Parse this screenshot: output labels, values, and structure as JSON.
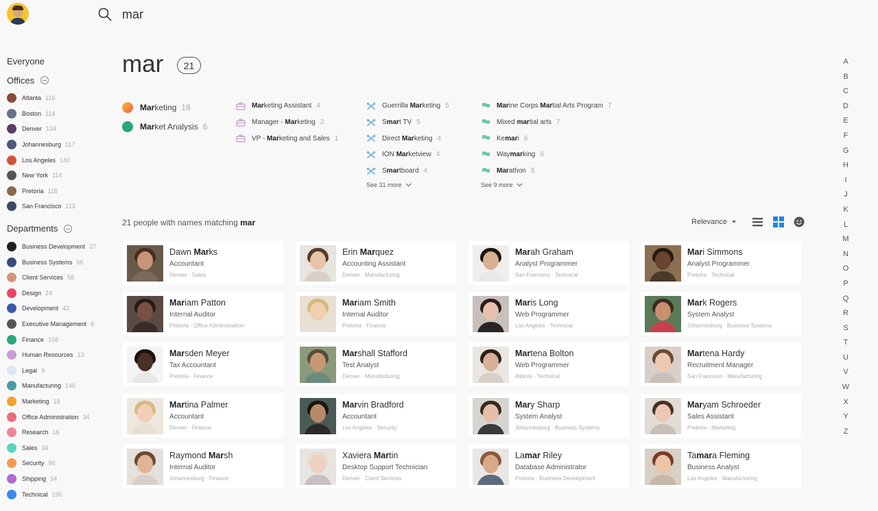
{
  "search": {
    "value": "mar",
    "placeholder": ""
  },
  "sidebar": {
    "everyone": "Everyone",
    "offices_label": "Offices",
    "offices": [
      {
        "label": "Atlanta",
        "count": "116",
        "color": "#8a4a3a"
      },
      {
        "label": "Boston",
        "count": "114",
        "color": "#6a7088"
      },
      {
        "label": "Denver",
        "count": "134",
        "color": "#5a3a6a"
      },
      {
        "label": "Johannesburg",
        "count": "117",
        "color": "#4a5a7a"
      },
      {
        "label": "Los Angeles",
        "count": "140",
        "color": "#d2553a"
      },
      {
        "label": "New York",
        "count": "114",
        "color": "#555555"
      },
      {
        "label": "Pretoria",
        "count": "118",
        "color": "#8a6a4a"
      },
      {
        "label": "San Francisco",
        "count": "113",
        "color": "#3a4a6a"
      }
    ],
    "departments_label": "Departments",
    "departments": [
      {
        "label": "Business Development",
        "count": "27",
        "color": "#222222"
      },
      {
        "label": "Business Systems",
        "count": "66",
        "color": "#3a4a7a"
      },
      {
        "label": "Client Services",
        "count": "58",
        "color": "#d4967a"
      },
      {
        "label": "Design",
        "count": "24",
        "color": "#ee4466"
      },
      {
        "label": "Development",
        "count": "42",
        "color": "#3a5aa8"
      },
      {
        "label": "Executive Management",
        "count": "8",
        "color": "#555555"
      },
      {
        "label": "Finance",
        "count": "158",
        "color": "#2aa878"
      },
      {
        "label": "Human Resources",
        "count": "13",
        "color": "#c89ad8"
      },
      {
        "label": "Legal",
        "count": "9",
        "color": "#dde4f4"
      },
      {
        "label": "Manufacturing",
        "count": "146",
        "color": "#4a9aa8"
      },
      {
        "label": "Marketing",
        "count": "18",
        "color": "#f6a030"
      },
      {
        "label": "Office Administration",
        "count": "34",
        "color": "#ee6a7a"
      },
      {
        "label": "Research",
        "count": "16",
        "color": "#f2849a"
      },
      {
        "label": "Sales",
        "count": "34",
        "color": "#5ad4be"
      },
      {
        "label": "Security",
        "count": "90",
        "color": "#f69a4a"
      },
      {
        "label": "Shipping",
        "count": "34",
        "color": "#b06ad8"
      },
      {
        "label": "Technical",
        "count": "195",
        "color": "#3a8af0"
      }
    ]
  },
  "query": {
    "title": "mar",
    "count": "21"
  },
  "suggestions": {
    "departments": [
      {
        "bold": "Mar",
        "rest": "keting",
        "count": "18",
        "color": "#f6a030"
      },
      {
        "bold": "Mar",
        "rest": "ket Analysis",
        "count": "6",
        "color": "#2aa878"
      }
    ],
    "titles": [
      {
        "pre": "",
        "bold": "Mar",
        "rest": "keting Assistant",
        "count": "4"
      },
      {
        "pre": "Manager - ",
        "bold": "Mar",
        "rest": "keting",
        "count": "2"
      },
      {
        "pre": "VP - ",
        "bold": "Mar",
        "rest": "keting and Sales",
        "count": "1"
      }
    ],
    "skills": [
      {
        "pre": "Guerrilla ",
        "bold": "Mar",
        "rest": "keting",
        "count": "5"
      },
      {
        "pre": "S",
        "bold": "mar",
        "rest": "t TV",
        "count": "5"
      },
      {
        "pre": "Direct ",
        "bold": "Mar",
        "rest": "keting",
        "count": "4"
      },
      {
        "pre": "ION ",
        "bold": "Mar",
        "rest": "ketview",
        "count": "4"
      },
      {
        "pre": "S",
        "bold": "mar",
        "rest": "tboard",
        "count": "4"
      }
    ],
    "skills_more": "See 31 more",
    "interests": [
      {
        "pre": "",
        "bold": "Mar",
        "rest": "ine Corps ",
        "bold2": "Mar",
        "rest2": "tial Arts Program",
        "count": "7"
      },
      {
        "pre": "Mixed ",
        "bold": "mar",
        "rest": "tial arts",
        "bold2": "",
        "rest2": "",
        "count": "7"
      },
      {
        "pre": "Ke",
        "bold": "mar",
        "rest": "i",
        "bold2": "",
        "rest2": "",
        "count": "6"
      },
      {
        "pre": "Way",
        "bold": "mar",
        "rest": "king",
        "bold2": "",
        "rest2": "",
        "count": "6"
      },
      {
        "pre": "",
        "bold": "Mar",
        "rest": "athon",
        "bold2": "",
        "rest2": "",
        "count": "5"
      }
    ],
    "interests_more": "See 9 more"
  },
  "results": {
    "label_prefix": "21 people with names matching ",
    "label_query": "mar",
    "sort_label": "Relevance"
  },
  "people": [
    {
      "bold": "",
      "pre": "Dawn ",
      "match": "Mar",
      "rest": "ks",
      "title": "Accountant",
      "location": "Denver · Sales",
      "skin": "#c89478",
      "hair": "#4a2e22",
      "shirt": "#7a6a5a",
      "bg": "#6a5a4a"
    },
    {
      "pre": "Erin ",
      "match": "Mar",
      "rest": "quez",
      "title": "Accounting Assistant",
      "location": "Denver · Manufacturing",
      "skin": "#e8c4a8",
      "hair": "#5a3a2a",
      "shirt": "#d8d0c8",
      "bg": "#e8e4e0"
    },
    {
      "pre": "",
      "match": "Mar",
      "rest": "ah Graham",
      "title": "Analyst Programmer",
      "location": "San Francisco · Technical",
      "skin": "#d8b090",
      "hair": "#1a1412",
      "shirt": "#e8e8e8",
      "bg": "#f0eeec"
    },
    {
      "pre": "",
      "match": "Mar",
      "rest": "i Simmons",
      "title": "Analyst Programmer",
      "location": "Pretoria · Technical",
      "skin": "#6a4430",
      "hair": "#2a1a12",
      "shirt": "#4a3a2a",
      "bg": "#8a7050"
    },
    {
      "pre": "",
      "match": "Mar",
      "rest": "iam Patton",
      "title": "Internal Auditor",
      "location": "Pretoria · Office Administration",
      "skin": "#7a5040",
      "hair": "#2a1a14",
      "shirt": "#3a2a2a",
      "bg": "#5a4a44"
    },
    {
      "pre": "",
      "match": "Mar",
      "rest": "iam Smith",
      "title": "Internal Auditor",
      "location": "Pretoria · Finance",
      "skin": "#f0d0b0",
      "hair": "#d8b878",
      "shirt": "#e8e0d8",
      "bg": "#e8e0d4"
    },
    {
      "pre": "",
      "match": "Mar",
      "rest": "is Long",
      "title": "Web Programmer",
      "location": "Los Angeles · Technical",
      "skin": "#e8c0b0",
      "hair": "#2a1e1a",
      "shirt": "#2a2424",
      "bg": "#c8c0bc"
    },
    {
      "pre": "",
      "match": "Mar",
      "rest": "k Rogers",
      "title": "System Analyst",
      "location": "Johannesburg · Business Systems",
      "skin": "#c89070",
      "hair": "#3a2a1e",
      "shirt": "#c84050",
      "bg": "#5a7a5a"
    },
    {
      "pre": "",
      "match": "Mar",
      "rest": "sden Meyer",
      "title": "Tax Accountant",
      "location": "Pretoria · Finance",
      "skin": "#4a3024",
      "hair": "#1a1210",
      "shirt": "#e8e8e8",
      "bg": "#f4f4f4"
    },
    {
      "pre": "",
      "match": "Mar",
      "rest": "shall Stafford",
      "title": "Test Analyst",
      "location": "Denver · Manufacturing",
      "skin": "#c89874",
      "hair": "#5a4a3a",
      "shirt": "#6a8a7a",
      "bg": "#8a9a7a"
    },
    {
      "pre": "",
      "match": "Mar",
      "rest": "tena Bolton",
      "title": "Web Programmer",
      "location": "Atlanta · Technical",
      "skin": "#d8b098",
      "hair": "#2a1e18",
      "shirt": "#d8d0c8",
      "bg": "#eae6e2"
    },
    {
      "pre": "",
      "match": "Mar",
      "rest": "tena Hardy",
      "title": "Recruitment Manager",
      "location": "San Francisco · Manufacturing",
      "skin": "#ecc8b0",
      "hair": "#6a4a34",
      "shirt": "#c8c0b8",
      "bg": "#d8d0c8"
    },
    {
      "pre": "",
      "match": "Mar",
      "rest": "tina Palmer",
      "title": "Accountant",
      "location": "Denver · Finance",
      "skin": "#f0d0b4",
      "hair": "#d8b884",
      "shirt": "#e8e0d0",
      "bg": "#ece8e0"
    },
    {
      "pre": "",
      "match": "Mar",
      "rest": "vin Bradford",
      "title": "Accountant",
      "location": "Los Angeles · Security",
      "skin": "#b88a6a",
      "hair": "#1a1412",
      "shirt": "#2a2a2a",
      "bg": "#4a5a54"
    },
    {
      "pre": "",
      "match": "Mar",
      "rest": "y Sharp",
      "title": "System Analyst",
      "location": "Johannesburg · Business Systems",
      "skin": "#e4c0a8",
      "hair": "#3a2a20",
      "shirt": "#3a3a3a",
      "bg": "#d8d4d0"
    },
    {
      "pre": "",
      "match": "Mar",
      "rest": "yam Schroeder",
      "title": "Sales Assistant",
      "location": "Pretoria · Marketing",
      "skin": "#ecc8b4",
      "hair": "#4a3024",
      "shirt": "#c8c0b8",
      "bg": "#e0dcd8"
    },
    {
      "pre": "Raymond ",
      "match": "Mar",
      "rest": "sh",
      "title": "Internal Auditor",
      "location": "Johannesburg · Finance",
      "skin": "#e0b494",
      "hair": "#6a4a30",
      "shirt": "#d8d0c8",
      "bg": "#e4e0dc"
    },
    {
      "pre": "Xaviera ",
      "match": "Mar",
      "rest": "tin",
      "title": "Desktop Support Technician",
      "location": "Denver · Client Services",
      "skin": "#ecd0c0",
      "hair": "#e8dcd0",
      "shirt": "#c8c0c0",
      "bg": "#e8e4e0"
    },
    {
      "pre": "La",
      "match": "mar",
      "rest": " Riley",
      "title": "Database Administrator",
      "location": "Pretoria · Business Development",
      "skin": "#d8a888",
      "hair": "#8a5a3a",
      "shirt": "#5a6a7a",
      "bg": "#e8e6e4"
    },
    {
      "pre": "Ta",
      "match": "mar",
      "rest": "a Fleming",
      "title": "Business Analyst",
      "location": "Los Angeles · Manufacturing",
      "skin": "#ecc4a8",
      "hair": "#7a3a24",
      "shirt": "#c8b8a8",
      "bg": "#d8d0c4"
    }
  ],
  "alphabet": [
    "A",
    "B",
    "C",
    "D",
    "E",
    "F",
    "G",
    "H",
    "I",
    "J",
    "K",
    "L",
    "M",
    "N",
    "O",
    "P",
    "Q",
    "R",
    "S",
    "T",
    "U",
    "V",
    "W",
    "X",
    "Y",
    "Z"
  ],
  "colors": {
    "accent": "#1e88e5",
    "titles_icon": "#c49ac8",
    "skills_icon": "#7ab8d8",
    "interests_icon": "#6ac8a8"
  }
}
